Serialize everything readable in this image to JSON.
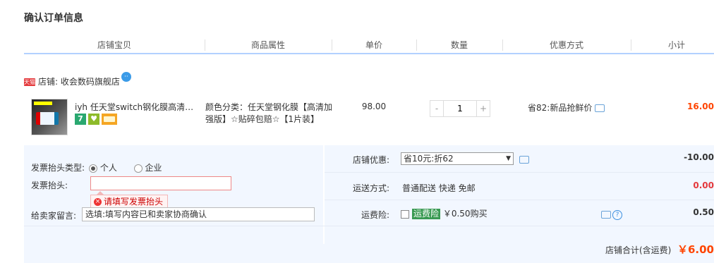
{
  "page": {
    "title": "确认订单信息"
  },
  "columns": [
    "店铺宝贝",
    "商品属性",
    "单价",
    "数量",
    "优惠方式",
    "小计"
  ],
  "shop": {
    "tag": "天猫",
    "label": "店铺:",
    "name": "收会数码旗舰店"
  },
  "item": {
    "title": "iyh 任天堂switch钢化膜高清防…",
    "badges": [
      {
        "icon": "seven-day-return-icon",
        "text": "7",
        "color": "#2aa870"
      },
      {
        "icon": "genuine-guarantee-icon",
        "text": "♥",
        "color": "#8dbb2a"
      },
      {
        "icon": "credit-card-icon",
        "text": "",
        "color": "#f5a623"
      }
    ],
    "attr_line1": "颜色分类：任天堂钢化膜【高清加",
    "attr_line2": "强版】☆贴碎包赔☆【1片装】",
    "price": "98.00",
    "quantity": "1",
    "discount": "省82:新品抢鲜价",
    "subtotal": "16.00"
  },
  "invoice": {
    "type_label": "发票抬头类型:",
    "option_personal": "个人",
    "option_company": "企业",
    "selected": "个人",
    "title_label": "发票抬头:",
    "title_value": "",
    "error": "请填写发票抬头"
  },
  "message": {
    "label": "给卖家留言:",
    "placeholder": "选填:填写内容已和卖家协商确认"
  },
  "shop_discount": {
    "label": "店铺优惠:",
    "selected": "省10元:折62",
    "value": "-10.00"
  },
  "shipping": {
    "label": "运送方式:",
    "method": "普通配送 快递 免邮",
    "value": "0.00"
  },
  "insurance": {
    "label": "运费险:",
    "tag": "运费险",
    "desc": "￥0.50购买",
    "value": "0.50"
  },
  "total": {
    "label": "店铺合计(含运费)",
    "value": "￥6.00"
  },
  "colors": {
    "accent": "#b2d1ff",
    "price_red": "#ff4400",
    "panel_bg": "#f2f7ff"
  }
}
